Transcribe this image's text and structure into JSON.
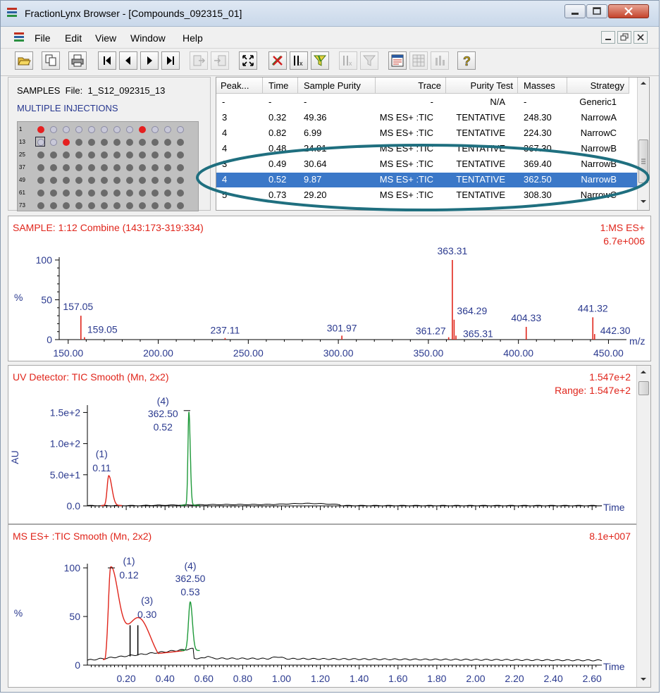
{
  "window": {
    "title": "FractionLynx Browser - [Compounds_092315_01]"
  },
  "menu": {
    "items": [
      "File",
      "Edit",
      "View",
      "Window",
      "Help"
    ]
  },
  "toolbar": {
    "icons": [
      "open-icon",
      "copy-icon",
      "print-icon",
      "first-icon",
      "prev-icon",
      "next-icon",
      "last-icon",
      "export-icon",
      "import-icon",
      "fit-icon",
      "tools-icon",
      "mass-filter-icon",
      "funnel-icon",
      "filter-disabled-icon",
      "funnel-disabled-icon",
      "report-icon",
      "grid-icon",
      "chart-icon",
      "help-icon"
    ]
  },
  "samples": {
    "label": "SAMPLES",
    "file_label": "File:",
    "file_name": "1_S12_092315_13",
    "mode": "MULTIPLE INJECTIONS",
    "row_labels": [
      "1",
      "13",
      "25",
      "37",
      "49",
      "61",
      "73"
    ]
  },
  "table": {
    "columns": [
      "Peak...",
      "Time",
      "Sample Purity",
      "Trace",
      "Purity Test",
      "Masses",
      "Strategy"
    ],
    "rows": [
      {
        "peak": "-",
        "time": "-",
        "purity": "-",
        "trace": "-",
        "test": "N/A",
        "masses": "-",
        "strategy": "Generic1"
      },
      {
        "peak": "3",
        "time": "0.32",
        "purity": "49.36",
        "trace": "MS ES+ :TIC",
        "test": "TENTATIVE",
        "masses": "248.30",
        "strategy": "NarrowA"
      },
      {
        "peak": "4",
        "time": "0.82",
        "purity": "6.99",
        "trace": "MS ES+ :TIC",
        "test": "TENTATIVE",
        "masses": "224.30",
        "strategy": "NarrowC"
      },
      {
        "peak": "4",
        "time": "0.48",
        "purity": "24.91",
        "trace": "MS ES+ :TIC",
        "test": "TENTATIVE",
        "masses": "367.30",
        "strategy": "NarrowB"
      },
      {
        "peak": "3",
        "time": "0.49",
        "purity": "30.64",
        "trace": "MS ES+ :TIC",
        "test": "TENTATIVE",
        "masses": "369.40",
        "strategy": "NarrowB"
      },
      {
        "peak": "4",
        "time": "0.52",
        "purity": "9.87",
        "trace": "MS ES+ :TIC",
        "test": "TENTATIVE",
        "masses": "362.50",
        "strategy": "NarrowB"
      },
      {
        "peak": "5",
        "time": "0.73",
        "purity": "29.20",
        "trace": "MS ES+ :TIC",
        "test": "TENTATIVE",
        "masses": "308.30",
        "strategy": "NarrowC"
      }
    ],
    "selected_row": 5
  },
  "spectrum": {
    "title": "SAMPLE: 1:12 Combine (143:173-319:334)",
    "detector": "1:MS ES+",
    "intensity": "6.7e+006",
    "ylabel": "%",
    "xlabel": "m/z"
  },
  "uv": {
    "title": "UV Detector: TIC Smooth (Mn, 2x2)",
    "max": "1.547e+2",
    "range": "Range: 1.547e+2",
    "ylabel": "AU",
    "xlabel": "Time"
  },
  "tic": {
    "title": "MS ES+ :TIC Smooth (Mn, 2x2)",
    "max": "8.1e+007",
    "ylabel": "%",
    "xlabel": "Time"
  },
  "colors": {
    "accent_red": "#e0251b",
    "axis_blue": "#2b3a8f",
    "highlight": "#3b78c8",
    "ellipse": "#1f6f7f",
    "uv_green": "#1f9a3a"
  },
  "chart_data": [
    {
      "type": "bar",
      "name": "mass-spectrum",
      "xlim": [
        145,
        460
      ],
      "ylim": [
        0,
        100
      ],
      "xticks": [
        "150.00",
        "200.00",
        "250.00",
        "300.00",
        "350.00",
        "400.00",
        "450.00"
      ],
      "yticks": [
        "0",
        "50",
        "100"
      ],
      "peaks": [
        {
          "x": 157.05,
          "y": 30,
          "label": "157.05"
        },
        {
          "x": 159.05,
          "y": 3,
          "label": "159.05"
        },
        {
          "x": 237.11,
          "y": 2,
          "label": "237.11"
        },
        {
          "x": 301.97,
          "y": 5,
          "label": "301.97"
        },
        {
          "x": 361.27,
          "y": 3,
          "label": "361.27"
        },
        {
          "x": 363.31,
          "y": 100,
          "label": "363.31"
        },
        {
          "x": 364.29,
          "y": 25,
          "label": "364.29"
        },
        {
          "x": 365.31,
          "y": 5,
          "label": "365.31"
        },
        {
          "x": 404.33,
          "y": 16,
          "label": "404.33"
        },
        {
          "x": 441.32,
          "y": 28,
          "label": "441.32"
        },
        {
          "x": 442.3,
          "y": 7,
          "label": "442.30"
        }
      ]
    },
    {
      "type": "line",
      "name": "uv-chromatogram",
      "xlim": [
        0.0,
        2.65
      ],
      "ylim": [
        0,
        155
      ],
      "yticks": [
        "0.0",
        "5.0e+1",
        "1.0e+2",
        "1.5e+2"
      ],
      "annotations": [
        {
          "peak": "(1)",
          "time": "0.11"
        },
        {
          "peak": "(4)",
          "mass": "362.50",
          "time": "0.52"
        }
      ]
    },
    {
      "type": "line",
      "name": "tic-chromatogram",
      "xlim": [
        0.0,
        2.65
      ],
      "ylim": [
        0,
        100
      ],
      "xticks": [
        "0.20",
        "0.40",
        "0.60",
        "0.80",
        "1.00",
        "1.20",
        "1.40",
        "1.60",
        "1.80",
        "2.00",
        "2.20",
        "2.40",
        "2.60"
      ],
      "yticks": [
        "0",
        "50",
        "100"
      ],
      "annotations": [
        {
          "peak": "(1)",
          "time": "0.12"
        },
        {
          "peak": "(3)",
          "time": "0.30"
        },
        {
          "peak": "(4)",
          "mass": "362.50",
          "time": "0.53"
        }
      ]
    }
  ]
}
